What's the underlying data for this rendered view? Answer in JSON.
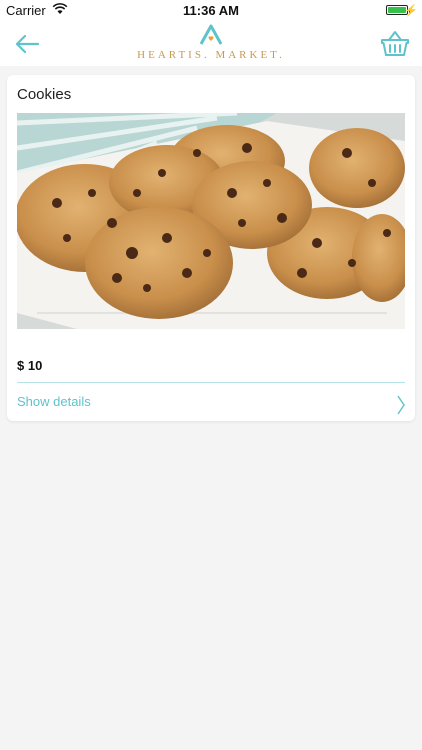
{
  "status_bar": {
    "carrier": "Carrier",
    "time": "11:36 AM",
    "battery_level": 1.0
  },
  "header": {
    "logo_text": "HEARTIS. MARKET.",
    "back_icon": "back-arrow-icon",
    "cart_icon": "basket-icon",
    "accent_color": "#5ec3cc",
    "brand_color": "#c79a52"
  },
  "product": {
    "title": "Cookies",
    "image_alt": "Cookies",
    "price": "$ 10",
    "details_label": "Show details"
  }
}
